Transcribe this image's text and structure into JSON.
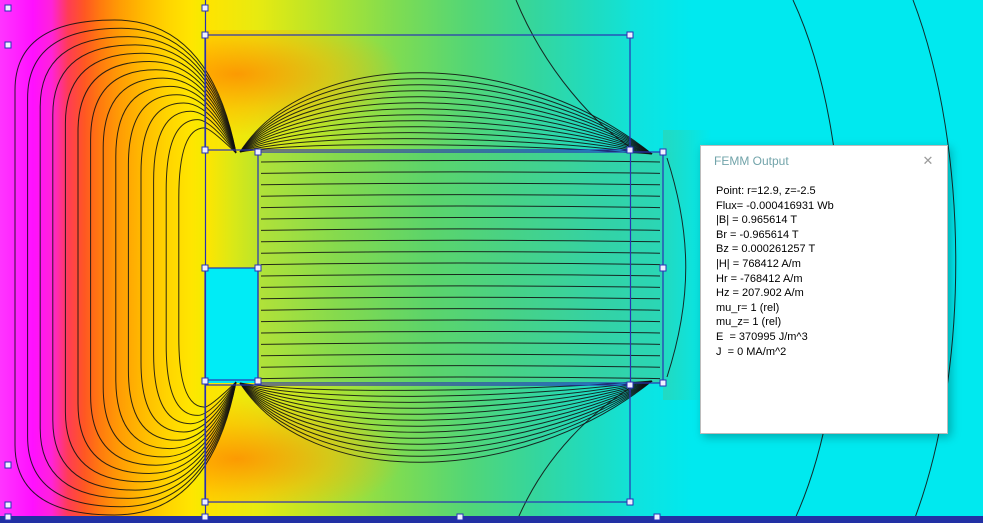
{
  "output_window": {
    "title": "FEMM Output",
    "close_label": "✕",
    "lines": [
      "Point: r=12.9, z=-2.5",
      "Flux= -0.000416931 Wb",
      "|B| = 0.965614 T",
      "Br = -0.965614 T",
      "Bz = 0.000261257 T",
      "|H| = 768412 A/m",
      "Hr = -768412 A/m",
      "Hz = 207.902 A/m",
      "mu_r= 1 (rel)",
      "mu_z= 1 (rel)",
      "E  = 370995 J/m^3",
      "J  = 0 MA/m^2"
    ],
    "point": {
      "r": 12.9,
      "z": -2.5
    },
    "values": {
      "Flux_Wb": -0.000416931,
      "B_mag_T": 0.965614,
      "Br_T": -0.965614,
      "Bz_T": 0.000261257,
      "H_mag_A_per_m": 768412,
      "Hr_A_per_m": -768412,
      "Hz_A_per_m": 207.902,
      "mu_r_rel": 1,
      "mu_z_rel": 1,
      "E_J_per_m3": 370995,
      "J_MA_per_m2": 0
    }
  },
  "colors": {
    "field_cyan": "#00e9ef",
    "field_magenta": "#ff14ff",
    "field_yellow": "#ffe400",
    "field_green": "#5cd46a",
    "geometry_blue": "#2832b4",
    "contour_color": "#111111",
    "boundary_navy": "#2130a4",
    "window_bg": "#ffffff",
    "title_color": "#72a4aa",
    "close_color": "#9b9b9b"
  }
}
